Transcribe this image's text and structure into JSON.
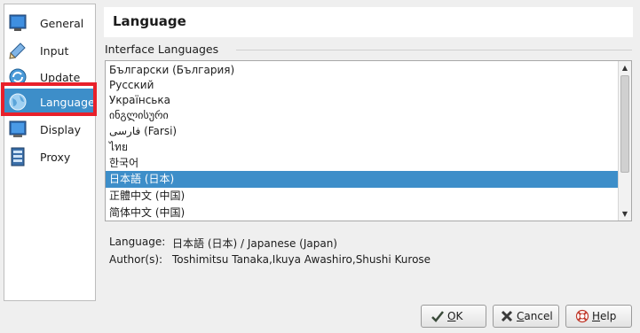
{
  "sidebar": {
    "items": [
      {
        "label": "General",
        "icon": "monitor-icon"
      },
      {
        "label": "Input",
        "icon": "pencil-icon"
      },
      {
        "label": "Update",
        "icon": "refresh-globe-icon"
      },
      {
        "label": "Language",
        "icon": "globe-icon",
        "active": true
      },
      {
        "label": "Display",
        "icon": "display-icon"
      },
      {
        "label": "Proxy",
        "icon": "server-icon"
      }
    ]
  },
  "header": {
    "title": "Language"
  },
  "languages": {
    "group_label": "Interface Languages",
    "items": [
      "Български (България)",
      "Русский",
      "Українська",
      "ინგლისური",
      "فارسی (Farsi)",
      "ไทย",
      "한국어",
      "日本語 (日本)",
      "正體中文 (中国)",
      "简体中文 (中国)"
    ],
    "selected_index": 7
  },
  "info": {
    "language_label": "Language:",
    "language_value": "日本語 (日本) / Japanese (Japan)",
    "authors_label": "Author(s):",
    "authors_value": "Toshimitsu Tanaka,Ikuya Awashiro,Shushi Kurose"
  },
  "buttons": {
    "ok": {
      "prefix": "",
      "mnemonic": "O",
      "rest": "K"
    },
    "cancel": {
      "prefix": "",
      "mnemonic": "C",
      "rest": "ancel"
    },
    "help": {
      "prefix": "",
      "mnemonic": "H",
      "rest": "elp"
    }
  },
  "colors": {
    "accent": "#3d8ec9",
    "highlight": "#e8202a"
  }
}
